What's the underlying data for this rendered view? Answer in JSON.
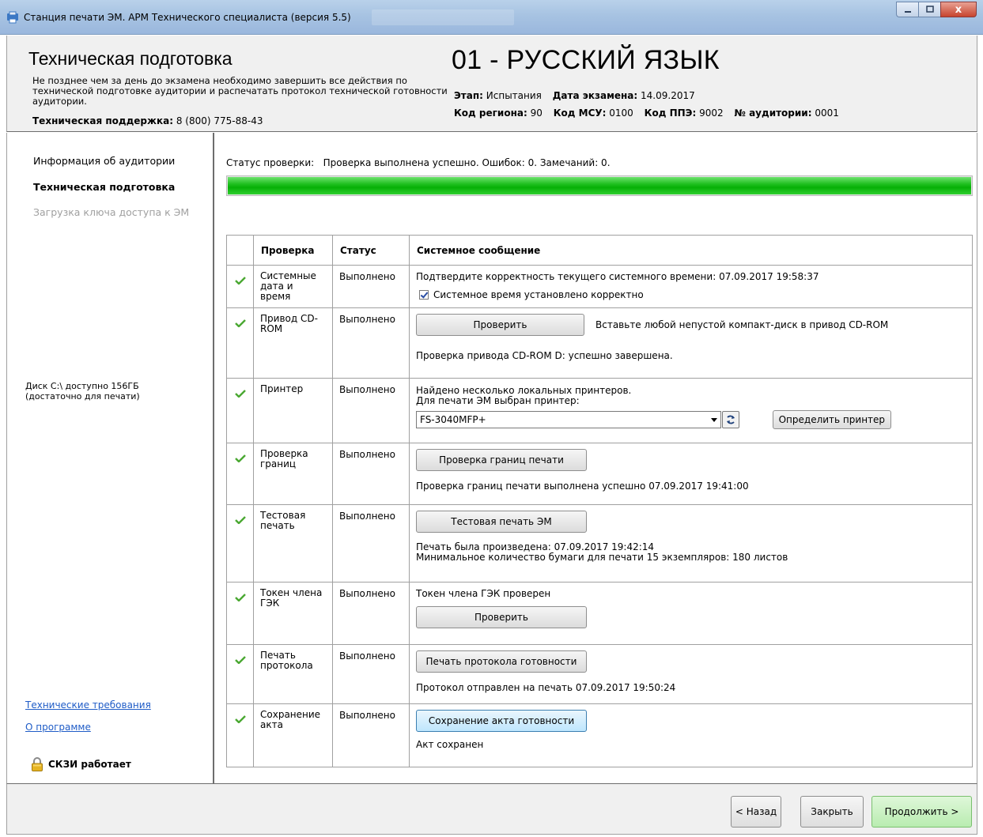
{
  "window": {
    "title": "Станция печати ЭМ. АРМ Технического специалиста (версия 5.5)",
    "buttons": {
      "minimize": "–",
      "maximize": "▫",
      "close": "x"
    }
  },
  "header": {
    "title": "Техническая подготовка",
    "description": "Не позднее чем за день до экзамена необходимо завершить все действия по технической подготовке аудитории и распечатать протокол технической готовности аудитории.",
    "support_label": "Техническая поддержка:",
    "support_phone": "8 (800) 775-88-43",
    "subject": "01 - РУССКИЙ ЯЗЫК",
    "stage_label": "Этап:",
    "stage_value": "Испытания",
    "exam_date_label": "Дата экзамена:",
    "exam_date_value": "14.09.2017",
    "region_label": "Код региона:",
    "region_value": "90",
    "msu_label": "Код МСУ:",
    "msu_value": "0100",
    "ppe_label": "Код ППЭ:",
    "ppe_value": "9002",
    "room_label": "№ аудитории:",
    "room_value": "0001"
  },
  "sidebar": {
    "items": [
      {
        "label": "Информация об аудитории",
        "state": "normal"
      },
      {
        "label": "Техническая подготовка",
        "state": "active"
      },
      {
        "label": "Загрузка ключа доступа к ЭМ",
        "state": "disabled"
      }
    ],
    "disk_info": "Диск C:\\ доступно 156ГБ\n(достаточно для печати)",
    "links": [
      "Технические требования",
      "О программе"
    ],
    "skzi_status": "СКЗИ работает"
  },
  "main": {
    "status_label": "Статус проверки:",
    "status_text": "Проверка выполнена успешно. Ошибок: 0. Замечаний: 0.",
    "progress_fraction": 1.0,
    "columns": [
      "Проверка",
      "Статус",
      "Системное сообщение"
    ],
    "rows": [
      {
        "name": "Системные дата и время",
        "status": "Выполнено",
        "message": "Подтвердите корректность текущего системного времени: 07.09.2017 19:58:37",
        "checkbox_label": "Системное время установлено корректно",
        "checkbox_checked": true
      },
      {
        "name": "Привод CD-ROM",
        "status": "Выполнено",
        "button": "Проверить",
        "hint": "Вставьте любой непустой компакт-диск в привод CD-ROM",
        "result": "Проверка привода CD-ROM D: успешно завершена."
      },
      {
        "name": "Принтер",
        "status": "Выполнено",
        "message1": "Найдено несколько локальных принтеров.",
        "message2": "Для печати ЭМ выбран принтер:",
        "printer_selected": "FS-3040MFP+",
        "button": "Определить принтер"
      },
      {
        "name": "Проверка границ",
        "status": "Выполнено",
        "button": "Проверка границ печати",
        "result": "Проверка границ печати выполнена успешно 07.09.2017 19:41:00"
      },
      {
        "name": "Тестовая печать",
        "status": "Выполнено",
        "button": "Тестовая печать ЭМ",
        "result1": "Печать была произведена: 07.09.2017 19:42:14",
        "result2": "Минимальное количество бумаги для печати 15 экземпляров: 180 листов"
      },
      {
        "name": "Токен члена ГЭК",
        "status": "Выполнено",
        "message": "Токен члена ГЭК проверен",
        "button": "Проверить"
      },
      {
        "name": "Печать протокола",
        "status": "Выполнено",
        "button": "Печать протокола готовности",
        "result": "Протокол отправлен на печать 07.09.2017 19:50:24"
      },
      {
        "name": "Сохранение акта",
        "status": "Выполнено",
        "button": "Сохранение акта готовности",
        "result": "Акт сохранен"
      }
    ]
  },
  "footer": {
    "back": "< Назад",
    "close": "Закрыть",
    "next": "Продолжить >"
  },
  "colors": {
    "progress": "#08b508",
    "check": "#4aa832",
    "link": "#1f5cc7",
    "next_button": "#c6f0be"
  }
}
